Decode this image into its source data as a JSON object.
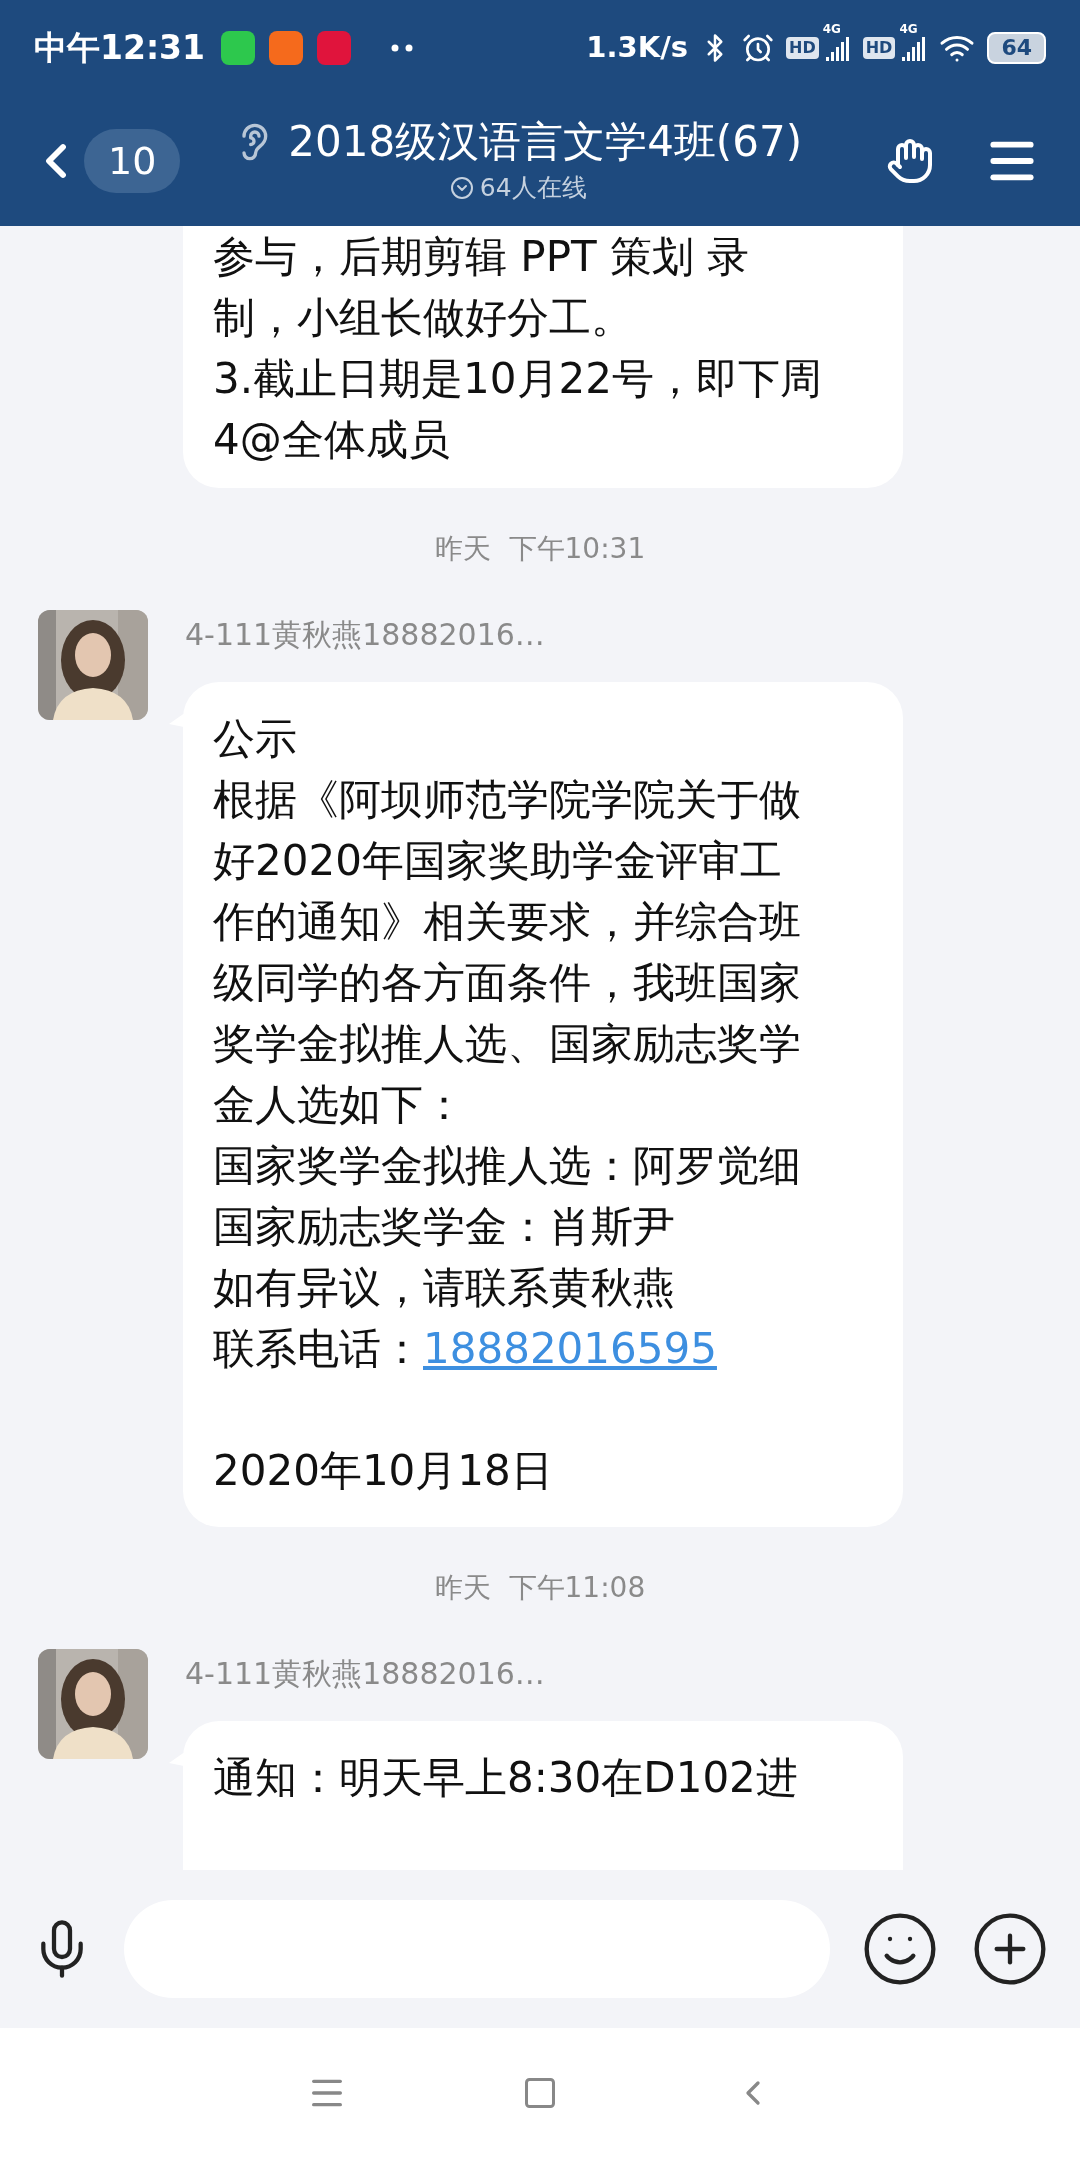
{
  "status_bar": {
    "time": "中午12:31",
    "speed": "1.3K/s",
    "sim_1": {
      "hd": "HD",
      "network": "4G"
    },
    "sim_2": {
      "hd": "HD",
      "network": "4G"
    },
    "battery": "64"
  },
  "header": {
    "unread": "10",
    "title": "2018级汉语言文学4班(67)",
    "online": "64人在线"
  },
  "messages": [
    {
      "kind": "continued",
      "paragraphs": [
        [
          {
            "text": "参与，后期剪辑  PPT  策划 录"
          },
          {
            "text": "制，小组长做好分工。"
          },
          {
            "text": "3.截止日期是10月22号，即下周"
          },
          {
            "text": "4@全体成员"
          }
        ]
      ]
    },
    {
      "kind": "time",
      "text": "昨天  下午10:31"
    },
    {
      "kind": "bubble",
      "sender": "4-111黄秋燕18882016…",
      "paragraphs": [
        [
          {
            "text": "公示"
          },
          {
            "text": "根据《阿坝师范学院学院关于做"
          },
          {
            "text": "好2020年国家奖助学金评审工"
          },
          {
            "text": "作的通知》相关要求，并综合班"
          },
          {
            "text": "级同学的各方面条件，我班国家"
          },
          {
            "text": "奖学金拟推人选、国家励志奖学"
          },
          {
            "text": "金人选如下："
          },
          {
            "text": "国家奖学金拟推人选：阿罗觉细"
          },
          {
            "text": "国家励志奖学金：肖斯尹"
          },
          {
            "text": "如有异议，请联系黄秋燕"
          },
          {
            "text": "联系电话：",
            "link": "18882016595"
          }
        ],
        [
          {
            "text": "2020年10月18日"
          }
        ]
      ]
    },
    {
      "kind": "time",
      "text": "昨天  下午11:08"
    },
    {
      "kind": "bubble",
      "sender": "4-111黄秋燕18882016…",
      "paragraphs": [
        [
          {
            "text": "通知：明天早上8:30在D102进"
          }
        ]
      ]
    }
  ]
}
